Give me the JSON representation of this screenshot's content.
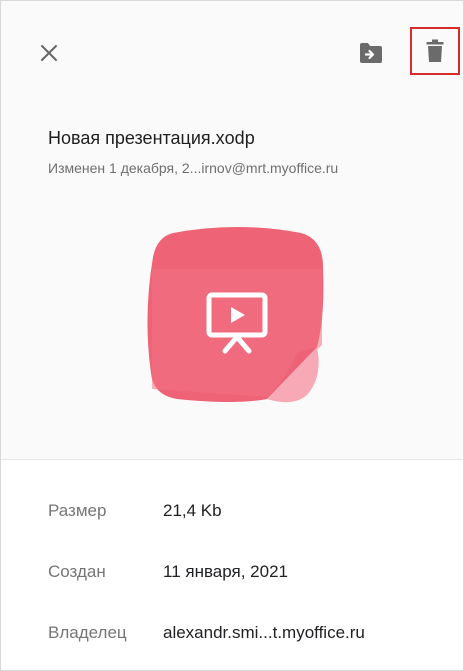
{
  "header": {
    "close_icon": "close-icon",
    "move_icon": "folder-move-icon",
    "delete_icon": "trash-icon",
    "highlight_color": "#d62b2b"
  },
  "file": {
    "name": "Новая презентация.xodp",
    "modified": "Изменен 1 декабря, 2...irnov@mrt.myoffice.ru",
    "thumb_icon": "presentation-file-icon",
    "thumb_color": "#ee6375"
  },
  "details": {
    "size_label": "Размер",
    "size_value": "21,4 Kb",
    "created_label": "Создан",
    "created_value": "11 января, 2021",
    "owner_label": "Владелец",
    "owner_value": "alexandr.smi...t.myoffice.ru"
  }
}
